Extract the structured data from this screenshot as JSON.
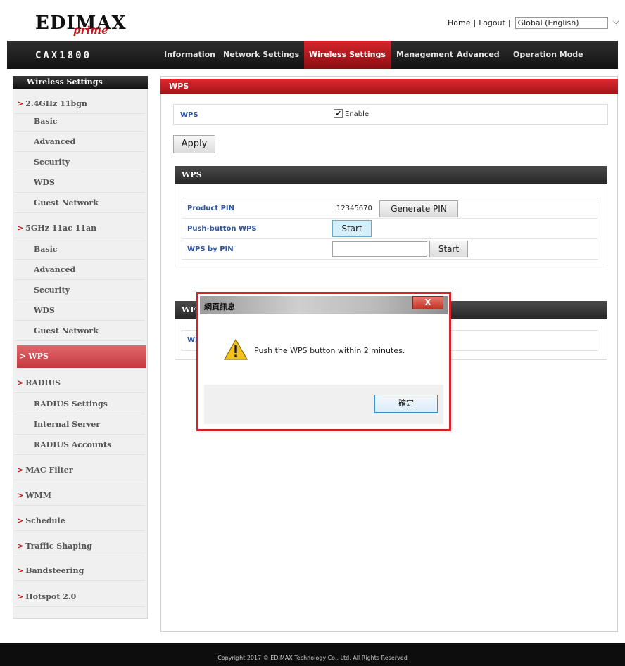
{
  "brand": {
    "name": "EDIMAX",
    "sub": "prime",
    "model": "CAX1800"
  },
  "top_links": {
    "home": "Home",
    "sep1": "|",
    "logout": "Logout",
    "sep2": "|",
    "language": "Global (English)"
  },
  "nav": {
    "tabs": [
      "Information",
      "Network Settings",
      "Wireless Settings",
      "Management",
      "Advanced",
      "Operation Mode"
    ],
    "active": "Wireless Settings"
  },
  "sidebar": {
    "title": "Wireless Settings",
    "items": [
      {
        "label": "2.4GHz 11bgn",
        "type": "group"
      },
      {
        "label": "Basic",
        "type": "sub"
      },
      {
        "label": "Advanced",
        "type": "sub"
      },
      {
        "label": "Security",
        "type": "sub"
      },
      {
        "label": "WDS",
        "type": "sub"
      },
      {
        "label": "Guest Network",
        "type": "sub"
      },
      {
        "label": "5GHz 11ac 11an",
        "type": "group"
      },
      {
        "label": "Basic",
        "type": "sub"
      },
      {
        "label": "Advanced",
        "type": "sub"
      },
      {
        "label": "Security",
        "type": "sub"
      },
      {
        "label": "WDS",
        "type": "sub"
      },
      {
        "label": "Guest Network",
        "type": "sub"
      },
      {
        "label": "WPS",
        "type": "active"
      },
      {
        "label": "RADIUS",
        "type": "group"
      },
      {
        "label": "RADIUS Settings",
        "type": "sub"
      },
      {
        "label": "Internal Server",
        "type": "sub"
      },
      {
        "label": "RADIUS Accounts",
        "type": "sub"
      },
      {
        "label": "MAC Filter",
        "type": "group"
      },
      {
        "label": "WMM",
        "type": "group"
      },
      {
        "label": "Schedule",
        "type": "group"
      },
      {
        "label": "Traffic Shaping",
        "type": "group"
      },
      {
        "label": "Bandsteering",
        "type": "group"
      },
      {
        "label": "Hotspot 2.0",
        "type": "group"
      }
    ]
  },
  "main": {
    "header": "WPS",
    "wps_label": "WPS",
    "enable_label": "Enable",
    "enabled": true,
    "apply_label": "Apply",
    "section": {
      "title": "WPS",
      "product_pin_label": "Product PIN",
      "product_pin_value": "12345670",
      "generate_pin_label": "Generate PIN",
      "push_button_label": "Push-button WPS",
      "push_start_label": "Start",
      "wps_by_pin_label": "WPS by PIN",
      "pin_start_label": "Start",
      "pin_input_value": ""
    },
    "second_section": {
      "title_fragment": "WF",
      "label_fragment": "WI"
    }
  },
  "dialog": {
    "title": "網頁訊息",
    "close_label": "X",
    "message": "Push the WPS button within 2 minutes.",
    "ok_label": "確定",
    "icon": "warning-icon"
  },
  "footer": {
    "text": "Copyright 2017 © EDIMAX Technology Co., Ltd. All Rights Reserved"
  },
  "colors": {
    "accent": "#c8151d",
    "label_blue": "#2f55a0",
    "dark_bar": "#1a1a1a"
  }
}
